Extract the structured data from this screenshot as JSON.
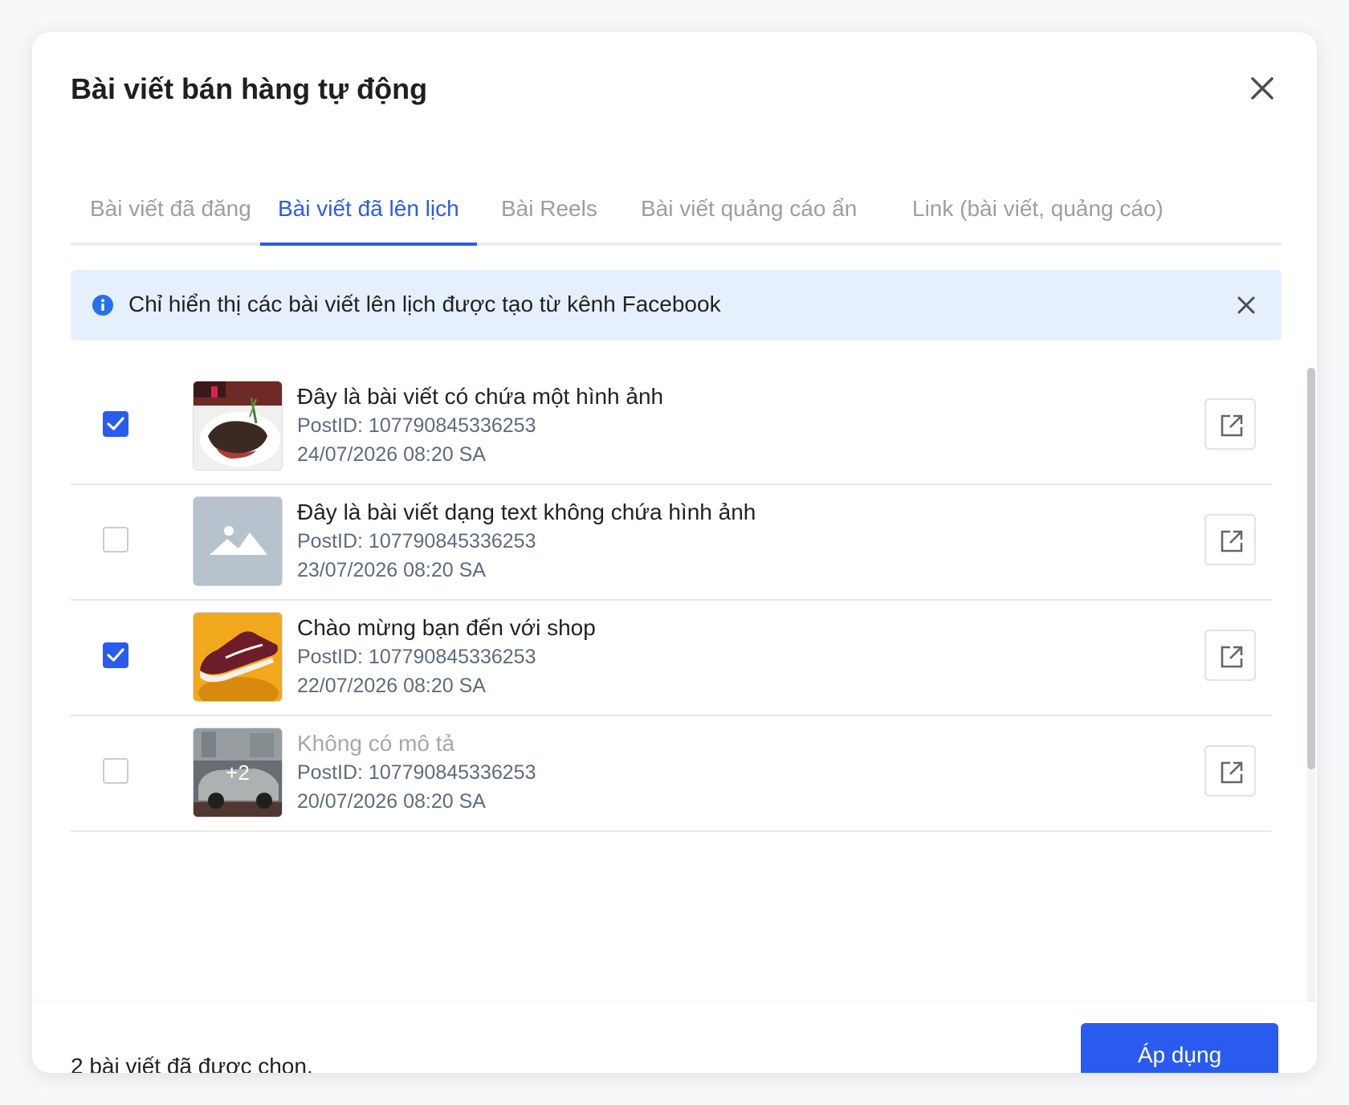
{
  "dialog": {
    "title": "Bài viết bán hàng tự động"
  },
  "tabs": [
    {
      "label": "Bài viết đã đăng",
      "active": false
    },
    {
      "label": "Bài viết đã lên lịch",
      "active": true
    },
    {
      "label": "Bài Reels",
      "active": false
    },
    {
      "label": "Bài viết quảng cáo ẩn",
      "active": false
    },
    {
      "label": "Link (bài viết, quảng cáo)",
      "active": false
    }
  ],
  "notice": {
    "text": "Chỉ hiển thị các bài viết lên lịch được tạo từ kênh Facebook"
  },
  "posts": [
    {
      "title": "Đây là bài viết có chứa một hình ảnh",
      "post_id": "PostID: 107790845336253",
      "date": "24/07/2026 08:20 SA",
      "checked": true,
      "thumb": "steak-photo"
    },
    {
      "title": "Đây là bài viết dạng text không chứa hình ảnh",
      "post_id": "PostID: 107790845336253",
      "date": "23/07/2026 08:20 SA",
      "checked": false,
      "thumb": "image-placeholder-icon"
    },
    {
      "title": "Chào mừng bạn đến với shop",
      "post_id": "PostID: 107790845336253",
      "date": "22/07/2026 08:20 SA",
      "checked": true,
      "thumb": "sneaker-photo"
    },
    {
      "title": "Không có mô tả",
      "post_id": "PostID: 107790845336253",
      "date": "20/07/2026 08:20 SA",
      "checked": false,
      "thumb": "car-photo",
      "badge": "+2"
    }
  ],
  "footer": {
    "selected_text": "2 bài viết đã được chọn.",
    "apply_label": "Áp dụng"
  },
  "colors": {
    "accent": "#2a5bf0",
    "notice_bg": "#e6f0fd"
  }
}
